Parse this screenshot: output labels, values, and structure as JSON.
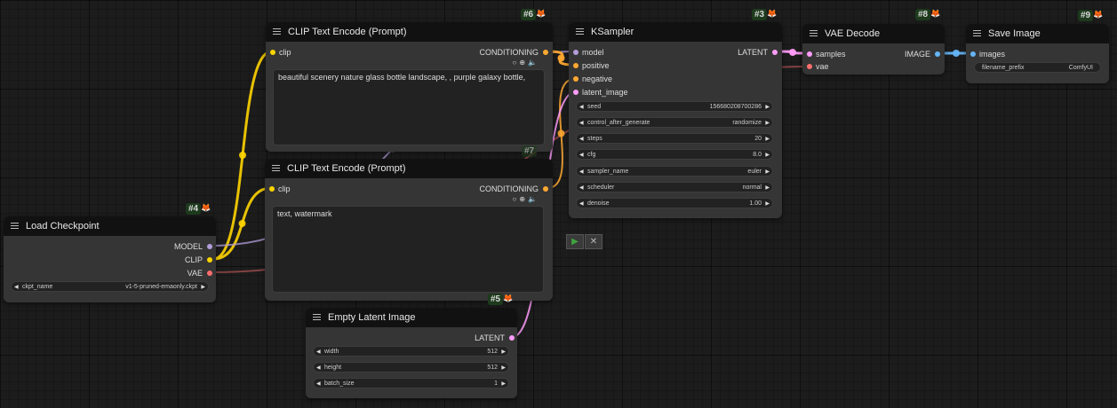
{
  "nodes": {
    "clip6": {
      "id": "#6",
      "title": "CLIP Text Encode (Prompt)",
      "input": "clip",
      "output": "CONDITIONING",
      "text": "beautiful scenery nature glass bottle landscape, , purple galaxy bottle,"
    },
    "clip7": {
      "id": "#7",
      "title": "CLIP Text Encode (Prompt)",
      "input": "clip",
      "output": "CONDITIONING",
      "text": "text, watermark"
    },
    "ksampler": {
      "id": "#3",
      "title": "KSampler",
      "inputs": [
        "model",
        "positive",
        "negative",
        "latent_image"
      ],
      "output": "LATENT",
      "widgets": [
        {
          "label": "seed",
          "value": "156680208700286"
        },
        {
          "label": "control_after_generate",
          "value": "randomize"
        },
        {
          "label": "steps",
          "value": "20"
        },
        {
          "label": "cfg",
          "value": "8.0"
        },
        {
          "label": "sampler_name",
          "value": "euler"
        },
        {
          "label": "scheduler",
          "value": "normal"
        },
        {
          "label": "denoise",
          "value": "1.00"
        }
      ]
    },
    "vaedecode": {
      "id": "#8",
      "title": "VAE Decode",
      "inputs": [
        "samples",
        "vae"
      ],
      "output": "IMAGE"
    },
    "saveimage": {
      "id": "#9",
      "title": "Save Image",
      "input": "images",
      "widget": {
        "label": "filename_prefix",
        "value": "ComfyUI"
      }
    },
    "checkpoint": {
      "id": "#4",
      "title": "Load Checkpoint",
      "outputs": [
        "MODEL",
        "CLIP",
        "VAE"
      ],
      "widget": {
        "label": "ckpt_name",
        "value": "v1-5-pruned-emaonly.ckpt"
      }
    },
    "latent": {
      "id": "#5",
      "title": "Empty Latent Image",
      "output": "LATENT",
      "widgets": [
        {
          "label": "width",
          "value": "512"
        },
        {
          "label": "height",
          "value": "512"
        },
        {
          "label": "batch_size",
          "value": "1"
        }
      ]
    }
  },
  "icons": {
    "badge": "fox-icon",
    "menu": "hamburger-icon",
    "conditioning_tools": [
      "circle-icon",
      "crosshair-icon",
      "speaker-icon"
    ]
  },
  "colors": {
    "model": "#b39ddb",
    "clip": "#ffd500",
    "vae": "#ff6e6e",
    "conditioning": "#ffa931",
    "latent": "#ff9cf9",
    "image": "#64b5f6",
    "node_bg": "#353535",
    "title_bg": "#111111",
    "canvas": "#1c1c1c"
  }
}
